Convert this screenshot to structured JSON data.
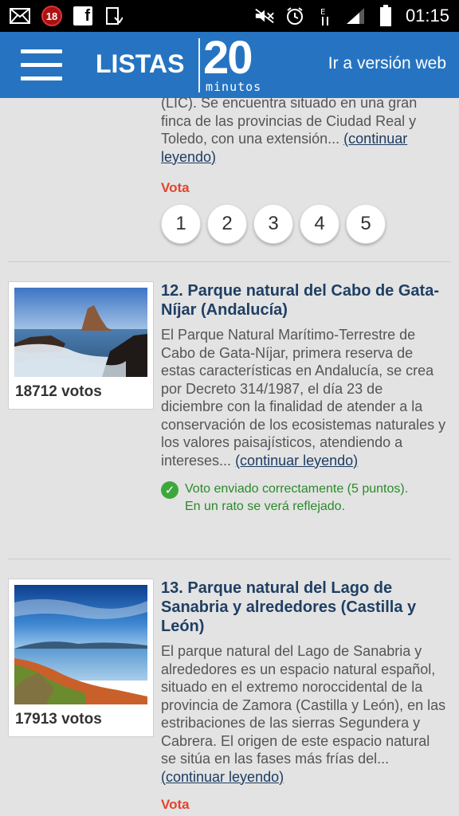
{
  "status_bar": {
    "notification_count": "18",
    "facebook_glyph": "f",
    "time": "01:15"
  },
  "header": {
    "brand_listas": "LISTAS",
    "brand_20": "20",
    "brand_minutos": "minutos",
    "web_version_link": "Ir a versión web"
  },
  "previous_item": {
    "desc_tail": "(LIC). Se encuentra situado en una gran finca de las provincias de Ciudad Real y Toledo, con una extensión...",
    "more_link": "(continuar leyendo)",
    "vota_label": "Vota",
    "rating_options": [
      "1",
      "2",
      "3",
      "4",
      "5"
    ]
  },
  "items": [
    {
      "title": "12. Parque natural del Cabo de Gata-Níjar (Andalucía)",
      "votes": "18712 votos",
      "description": "El Parque Natural Marítimo-Terrestre de Cabo de Gata-Níjar, primera reserva de estas características en Andalucía, se crea por Decreto 314/1987, el día 23 de diciembre con la finalidad de atender a la conservación de los ecosistemas naturales y los valores paisajísticos, atendiendo a intereses...",
      "more_link": "(continuar leyendo)",
      "success_line1": "Voto enviado correctamente (5 puntos).",
      "success_line2": "En un rato se verá reflejado."
    },
    {
      "title": "13. Parque natural del Lago de Sanabria y alrededores (Castilla y León)",
      "votes": "17913 votos",
      "description": "El parque natural del Lago de Sanabria y alrededores es un espacio natural español, situado en el extremo noroccidental de la provincia de Zamora (Castilla y León), en las estribaciones de las sierras Segundera y Cabrera. El origen de este espacio natural se sitúa en las fases más frías del...",
      "more_link": "(continuar leyendo)",
      "vota_label": "Vota"
    }
  ],
  "colors": {
    "header_blue": "#186cbe",
    "title_navy": "#1f3f63",
    "vota_red": "#e2452d",
    "success_green": "#2a8a2a"
  }
}
